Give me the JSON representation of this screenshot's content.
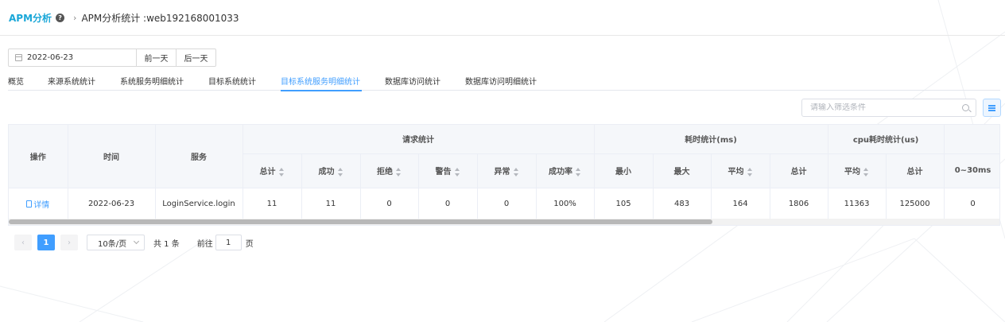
{
  "header": {
    "brand": "APM分析",
    "help_icon": "question-circle-icon",
    "breadcrumb": "APM分析统计 :web192168001033"
  },
  "date": {
    "value": "2022-06-23",
    "prev_label": "前一天",
    "next_label": "后一天"
  },
  "tabs": [
    {
      "label": "概览",
      "active": false
    },
    {
      "label": "来源系统统计",
      "active": false
    },
    {
      "label": "系统服务明细统计",
      "active": false
    },
    {
      "label": "目标系统统计",
      "active": false
    },
    {
      "label": "目标系统服务明细统计",
      "active": true
    },
    {
      "label": "数据库访问统计",
      "active": false
    },
    {
      "label": "数据库访问明细统计",
      "active": false
    }
  ],
  "filter": {
    "placeholder": "请输入筛选条件"
  },
  "table": {
    "groups": {
      "action": "操作",
      "time": "时间",
      "service": "服务",
      "request": "请求统计",
      "elapsed": "耗时统计(ms)",
      "cpu": "cpu耗时统计(us)"
    },
    "sub": {
      "total": "总计",
      "success": "成功",
      "reject": "拒绝",
      "warn": "警告",
      "error": "异常",
      "rate": "成功率",
      "min": "最小",
      "max": "最大",
      "avg": "平均",
      "sum": "总计",
      "cpu_avg": "平均",
      "cpu_sum": "总计",
      "bucket": "0~30ms"
    },
    "row": {
      "action": "详情",
      "time": "2022-06-23",
      "service": "LoginService.login",
      "total": "11",
      "success": "11",
      "reject": "0",
      "warn": "0",
      "error": "0",
      "rate": "100%",
      "min": "105",
      "max": "483",
      "avg": "164",
      "sum": "1806",
      "cpu_avg": "11363",
      "cpu_sum": "125000",
      "bucket": "0"
    },
    "scroll_fraction": 0.71
  },
  "pager": {
    "current": "1",
    "page_size": "10条/页",
    "total": "共 1 条",
    "goto_label": "前往",
    "goto_value": "1",
    "page_suffix": "页"
  },
  "colors": {
    "accent": "#409eff",
    "brand": "#1aa7d8"
  }
}
